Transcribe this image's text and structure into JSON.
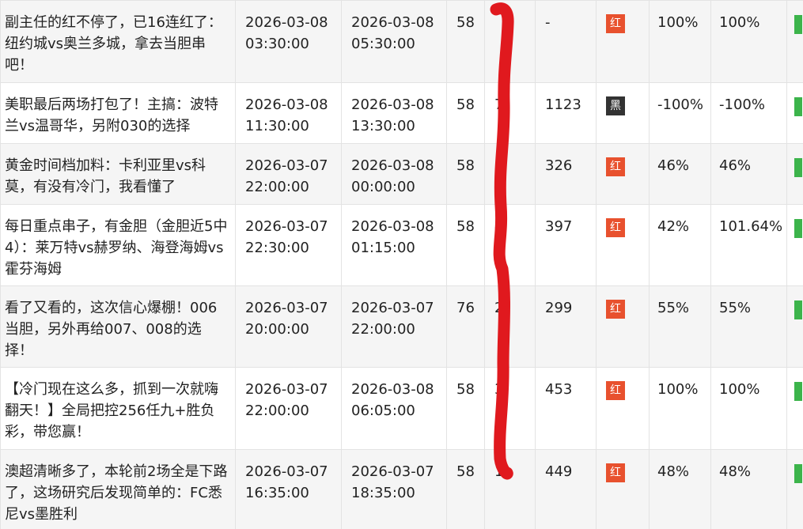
{
  "rows": [
    {
      "title": "副主任的红不停了，已16连红了：纽约城vs奥兰多城，拿去当胆串吧！",
      "start": [
        "2026-03-08",
        "03:30:00"
      ],
      "end": [
        "2026-03-08",
        "05:30:00"
      ],
      "price": "58",
      "sold": "",
      "views": "-",
      "result": "红",
      "result_kind": "red",
      "rate1": "100%",
      "rate2": "100%"
    },
    {
      "title": "美职最后两场打包了！主搞：波特兰vs温哥华，另附030的选择",
      "start": [
        "2026-03-08",
        "11:30:00"
      ],
      "end": [
        "2026-03-08",
        "13:30:00"
      ],
      "price": "58",
      "sold": "7",
      "views": "1123",
      "result": "黑",
      "result_kind": "black",
      "rate1": "-100%",
      "rate2": "-100%"
    },
    {
      "title": "黄金时间档加料：卡利亚里vs科莫，有没有冷门，我看懂了",
      "start": [
        "2026-03-07",
        "22:00:00"
      ],
      "end": [
        "2026-03-08",
        "00:00:00"
      ],
      "price": "58",
      "sold": "5",
      "views": "326",
      "result": "红",
      "result_kind": "red",
      "rate1": "46%",
      "rate2": "46%"
    },
    {
      "title": "每日重点串子，有金胆（金胆近5中4）：莱万特vs赫罗纳、海登海姆vs霍芬海姆",
      "start": [
        "2026-03-07",
        "22:30:00"
      ],
      "end": [
        "2026-03-08",
        "01:15:00"
      ],
      "price": "58",
      "sold": "4",
      "views": "397",
      "result": "红",
      "result_kind": "red",
      "rate1": "42%",
      "rate2": "101.64%"
    },
    {
      "title": "看了又看的，这次信心爆棚！006当胆，另外再给007、008的选择！",
      "start": [
        "2026-03-07",
        "20:00:00"
      ],
      "end": [
        "2026-03-07",
        "22:00:00"
      ],
      "price": "76",
      "sold": "2",
      "views": "299",
      "result": "红",
      "result_kind": "red",
      "rate1": "55%",
      "rate2": "55%"
    },
    {
      "title": "【冷门现在这么多，抓到一次就嗨翻天！】全局把控256任九+胜负彩，带您赢！",
      "start": [
        "2026-03-07",
        "22:00:00"
      ],
      "end": [
        "2026-03-08",
        "06:05:00"
      ],
      "price": "58",
      "sold": "3",
      "views": "453",
      "result": "红",
      "result_kind": "red",
      "rate1": "100%",
      "rate2": "100%"
    },
    {
      "title": "澳超清晰多了，本轮前2场全是下路了，这场研究后发现简单的：FC悉尼vs墨胜利",
      "start": [
        "2026-03-07",
        "16:35:00"
      ],
      "end": [
        "2026-03-07",
        "18:35:00"
      ],
      "price": "58",
      "sold": "1",
      "views": "449",
      "result": "红",
      "result_kind": "red",
      "rate1": "48%",
      "rate2": "48%"
    }
  ],
  "colors": {
    "red_badge": "#e8512e",
    "black_badge": "#333333",
    "status_bar": "#3cb44b",
    "scribble": "#e0191e"
  }
}
